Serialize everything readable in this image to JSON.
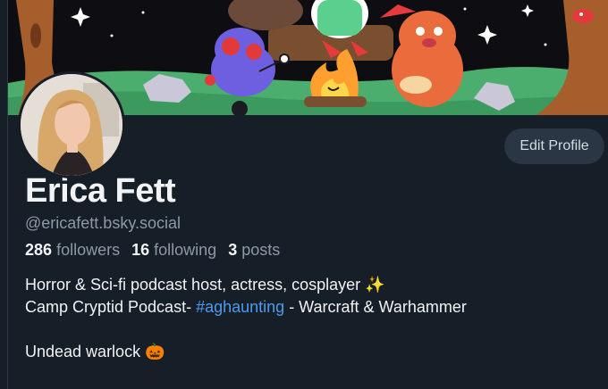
{
  "profile": {
    "display_name": "Erica Fett",
    "handle": "@ericafett.bsky.social",
    "edit_button_label": "Edit Profile",
    "stats": {
      "followers_count": "286",
      "followers_label": "followers",
      "following_count": "16",
      "following_label": "following",
      "posts_count": "3",
      "posts_label": "posts"
    },
    "bio": {
      "line1_text": "Horror & Sci-fi podcast host, actress, cosplayer",
      "line1_emoji": "✨",
      "line2_prefix": "Camp Cryptid Podcast- ",
      "line2_hashtag": "#aghaunting",
      "line2_suffix": " - Warcraft & Warhammer",
      "line3_text": "Undead warlock",
      "line3_emoji": "🎃"
    }
  },
  "colors": {
    "background": "#161e27",
    "accent_link": "#4c9bf0",
    "muted_text": "#8d99a6",
    "button_bg": "#2a3643"
  },
  "icons": [
    "sparkles-icon",
    "jack-o-lantern-icon"
  ]
}
